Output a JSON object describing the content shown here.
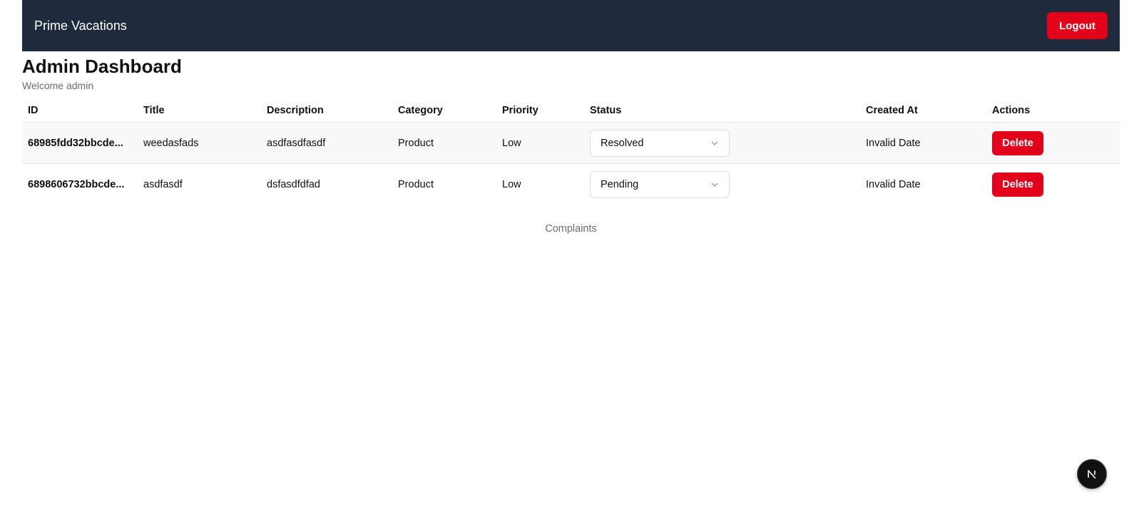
{
  "navbar": {
    "brand": "Prime Vacations",
    "logout_label": "Logout"
  },
  "header": {
    "title": "Admin Dashboard",
    "welcome": "Welcome admin"
  },
  "table": {
    "columns": [
      "ID",
      "Title",
      "Description",
      "Category",
      "Priority",
      "Status",
      "Created At",
      "Actions"
    ],
    "rows": [
      {
        "id": "68985fdd32bbcde...",
        "title": "weedasfads",
        "description": "asdfasdfasdf",
        "category": "Product",
        "priority": "Low",
        "status": "Resolved",
        "created_at": "Invalid Date",
        "action_label": "Delete"
      },
      {
        "id": "6898606732bbcde...",
        "title": "asdfasdf",
        "description": "dsfasdfdfad",
        "category": "Product",
        "priority": "Low",
        "status": "Pending",
        "created_at": "Invalid Date",
        "action_label": "Delete"
      }
    ]
  },
  "caption": "Complaints",
  "colors": {
    "navbar_bg": "#1f2a3c",
    "danger": "#e3001b"
  },
  "icons": {
    "status_dropdown": "chevron-down-icon",
    "dev_badge": "nextjs-logo-icon"
  }
}
